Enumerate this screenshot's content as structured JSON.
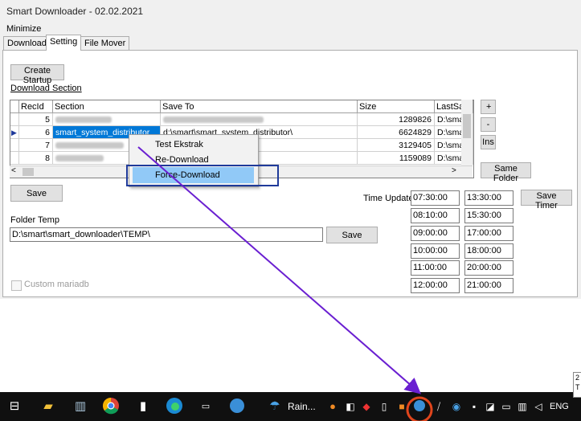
{
  "window": {
    "title": "Smart Downloader - 02.02.2021",
    "menu": "Minimize"
  },
  "tabs": [
    "Download",
    "Setting",
    "File Mover"
  ],
  "setting": {
    "create_startup": "Create Startup",
    "download_section": "Download Section",
    "grid": {
      "columns": [
        "RecId",
        "Section",
        "Save To",
        "Size",
        "LastSav"
      ],
      "rows": [
        {
          "id": "5",
          "section": "",
          "save_to": "",
          "size": "1289826",
          "last": "D:\\sma"
        },
        {
          "id": "6",
          "section": "smart_system_distributor",
          "save_to": "d:\\smart\\smart_system_distributor\\",
          "size": "6624829",
          "last": "D:\\sma"
        },
        {
          "id": "7",
          "section": "",
          "save_to": "",
          "size": "3129405",
          "last": "D:\\sma"
        },
        {
          "id": "8",
          "section": "",
          "save_to": "",
          "size": "1159089",
          "last": "D:\\sma"
        }
      ]
    },
    "side_buttons": {
      "plus": "+",
      "minus": "-",
      "ins": "Ins",
      "same_folder": "Same Folder"
    },
    "save_label": "Save",
    "folder_temp_label": "Folder Temp",
    "folder_temp_value": "D:\\smart\\smart_downloader\\TEMP\\",
    "folder_save_label": "Save",
    "custom_mariadb": "Custom mariadb",
    "time_update_label": "Time Update",
    "save_timer": "Save Timer",
    "times_left": [
      "07:30:00",
      "08:10:00",
      "09:00:00",
      "10:00:00",
      "11:00:00",
      "12:00:00"
    ],
    "times_right": [
      "13:30:00",
      "15:30:00",
      "17:00:00",
      "18:00:00",
      "20:00:00",
      "21:00:00"
    ]
  },
  "context_menu": [
    "Test Ekstrak",
    "Re-Download",
    "Force-Download"
  ],
  "taskbar": {
    "weather_text": "Rain...",
    "language": "ENG",
    "icons": [
      "task-view-icon",
      "file-explorer-icon",
      "recycle-icon",
      "chrome-icon",
      "notepad-icon",
      "edge-icon",
      "terminal-icon",
      "app-icon",
      "weather-icon",
      "tray-icons"
    ]
  },
  "tooltip": "2 T",
  "colors": {
    "selection": "#0078d7",
    "highlight": "#91c9f7",
    "arrow": "#6a1fd1",
    "circle": "#e0451c"
  }
}
